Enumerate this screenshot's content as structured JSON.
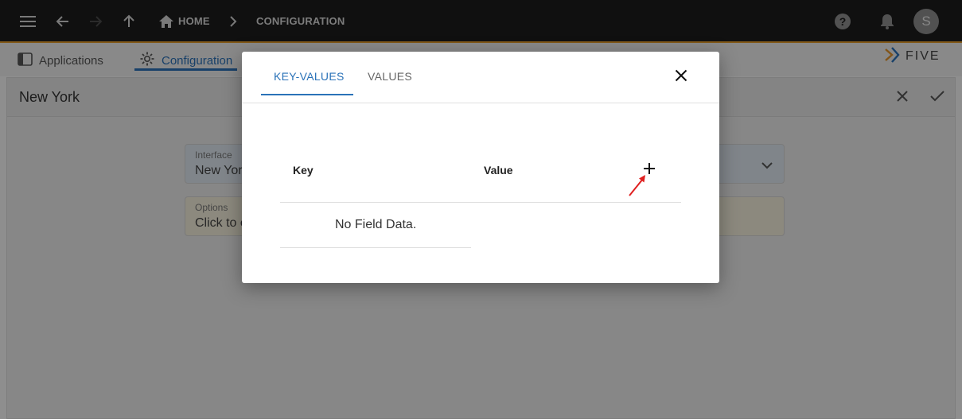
{
  "appbar": {
    "breadcrumb": {
      "home": "HOME",
      "current": "CONFIGURATION"
    },
    "avatar_initial": "S",
    "icons": [
      "menu-icon",
      "back-arrow-icon",
      "forward-arrow-icon",
      "up-arrow-icon",
      "home-icon",
      "chevron-right-icon",
      "help-icon",
      "bell-icon"
    ]
  },
  "subbar": {
    "tabs": [
      {
        "label": "Applications",
        "active": false
      },
      {
        "label": "Configuration",
        "active": true
      }
    ],
    "brand": "FIVE"
  },
  "form": {
    "title": "New York",
    "fields": [
      {
        "label": "Interface",
        "value": "New York"
      },
      {
        "label": "Options",
        "value": "Click to e"
      }
    ]
  },
  "dialog": {
    "tabs": [
      {
        "label": "KEY-VALUES",
        "active": true
      },
      {
        "label": "VALUES",
        "active": false
      }
    ],
    "columns": {
      "key": "Key",
      "value": "Value"
    },
    "empty_text": "No Field Data."
  },
  "colors": {
    "accent": "#2a72b8",
    "appbar": "#1c1c1c",
    "appbar_border": "#e09a2a",
    "annotation_arrow": "#e02020"
  }
}
